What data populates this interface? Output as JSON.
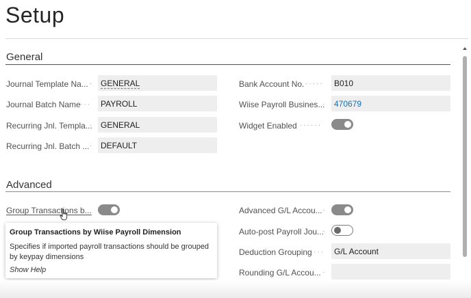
{
  "page": {
    "title": "Setup"
  },
  "general": {
    "title": "General",
    "left": [
      {
        "label": "Journal Template Na...",
        "value": "GENERAL"
      },
      {
        "label": "Journal Batch Name",
        "value": "PAYROLL"
      },
      {
        "label": "Recurring Jnl. Templa...",
        "value": "GENERAL"
      },
      {
        "label": "Recurring Jnl. Batch ...",
        "value": "DEFAULT"
      }
    ],
    "right": [
      {
        "label": "Bank Account No.",
        "value": "B010"
      },
      {
        "label": "Wiise Payroll Busines...",
        "value": "470679"
      },
      {
        "label": "Widget Enabled",
        "toggle": true
      }
    ]
  },
  "advanced": {
    "title": "Advanced",
    "left": [
      {
        "label": "Group Transactions b...",
        "toggle": true
      }
    ],
    "right": [
      {
        "label": "Advanced G/L Accou...",
        "toggle": true
      },
      {
        "label": "Auto-post Payroll Jou...",
        "toggle": false
      },
      {
        "label": "Deduction Grouping",
        "value": "G/L Account"
      },
      {
        "label": "Rounding G/L Accou...",
        "value": ""
      }
    ]
  },
  "tooltip": {
    "title": "Group Transactions by Wiise Payroll Dimension",
    "body": "Specifies if imported payroll transactions should be grouped by keypay dimensions",
    "help": "Show Help"
  },
  "colors": {
    "link": "#1a6fb0",
    "toggle_on": "#8a8a8a",
    "field_bg": "#eeeeee"
  },
  "icons": {
    "cursor": "hand-pointer-icon",
    "scroll_up": "chevron-up-icon"
  }
}
